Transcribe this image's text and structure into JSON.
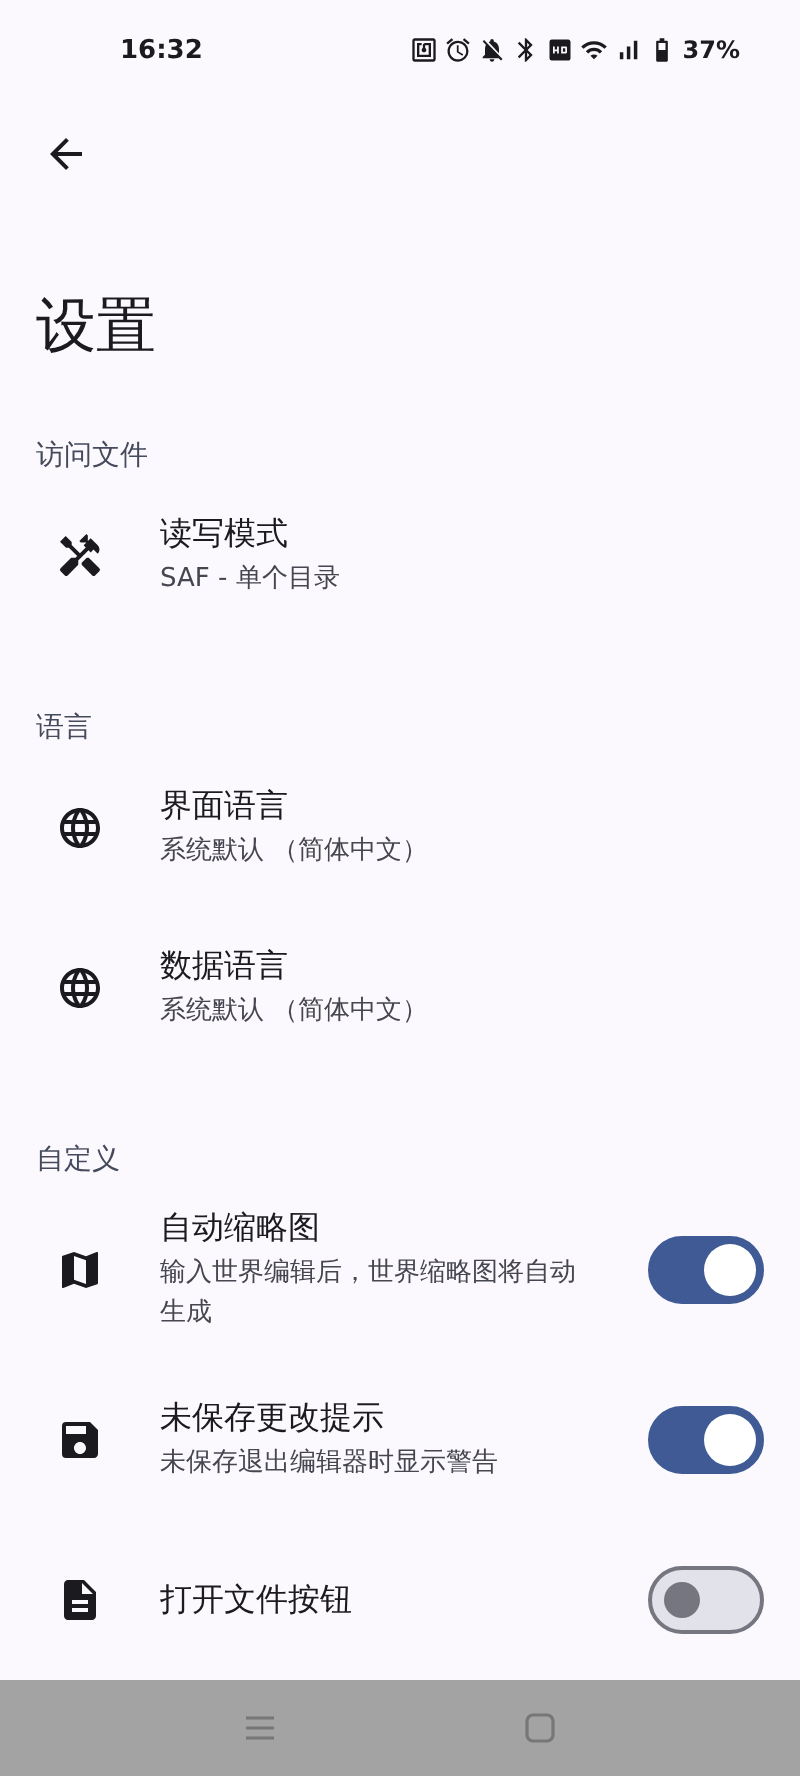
{
  "status_bar": {
    "time": "16:32",
    "battery": "37%"
  },
  "title": "设置",
  "sections": [
    {
      "header": "访问文件",
      "items": [
        {
          "kind": "link",
          "title": "读写模式",
          "subtitle": "SAF - 单个目录"
        }
      ]
    },
    {
      "header": "语言",
      "items": [
        {
          "kind": "link",
          "title": "界面语言",
          "subtitle": "系统默认 （简体中文）"
        },
        {
          "kind": "link",
          "title": "数据语言",
          "subtitle": "系统默认 （简体中文）"
        }
      ]
    },
    {
      "header": "自定义",
      "items": [
        {
          "kind": "toggle",
          "title": "自动缩略图",
          "subtitle": "输入世界编辑后，世界缩略图将自动生成",
          "on": true
        },
        {
          "kind": "toggle",
          "title": "未保存更改提示",
          "subtitle": "未保存退出编辑器时显示警告",
          "on": true
        },
        {
          "kind": "toggle",
          "title": "打开文件按钮",
          "on": false
        }
      ]
    }
  ]
}
